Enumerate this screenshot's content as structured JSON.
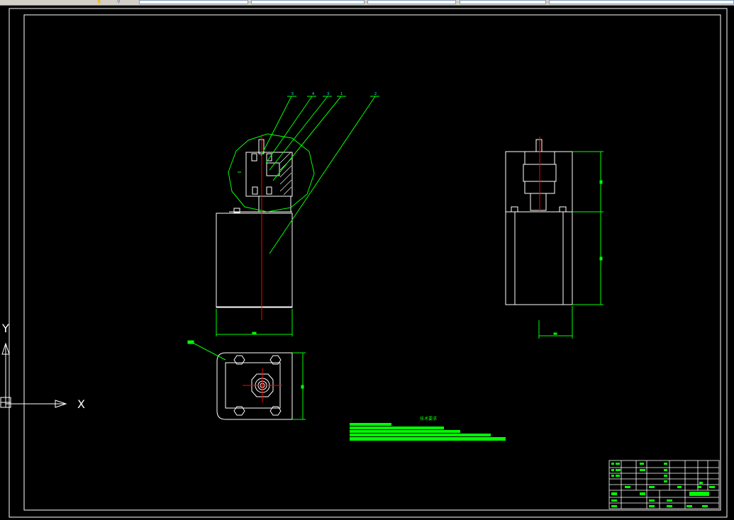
{
  "toolbar": {
    "icons": [
      "pan-icon",
      "zoom-icon"
    ],
    "fields": [
      "layer-dropdown",
      "linetype-dropdown",
      "lineweight-dropdown",
      "color-dropdown",
      "plotstyle-dropdown"
    ]
  },
  "ucs": {
    "x_label": "X",
    "y_label": "Y"
  },
  "colors": {
    "background": "#000000",
    "border": "#ffffff",
    "dimension": "#00ff00",
    "centerline": "#ff0000",
    "leader_label": "#00ffff"
  },
  "callouts": [
    "5",
    "4",
    "3",
    "1",
    "2"
  ],
  "title_block": {
    "note_heading": "技术要求"
  }
}
